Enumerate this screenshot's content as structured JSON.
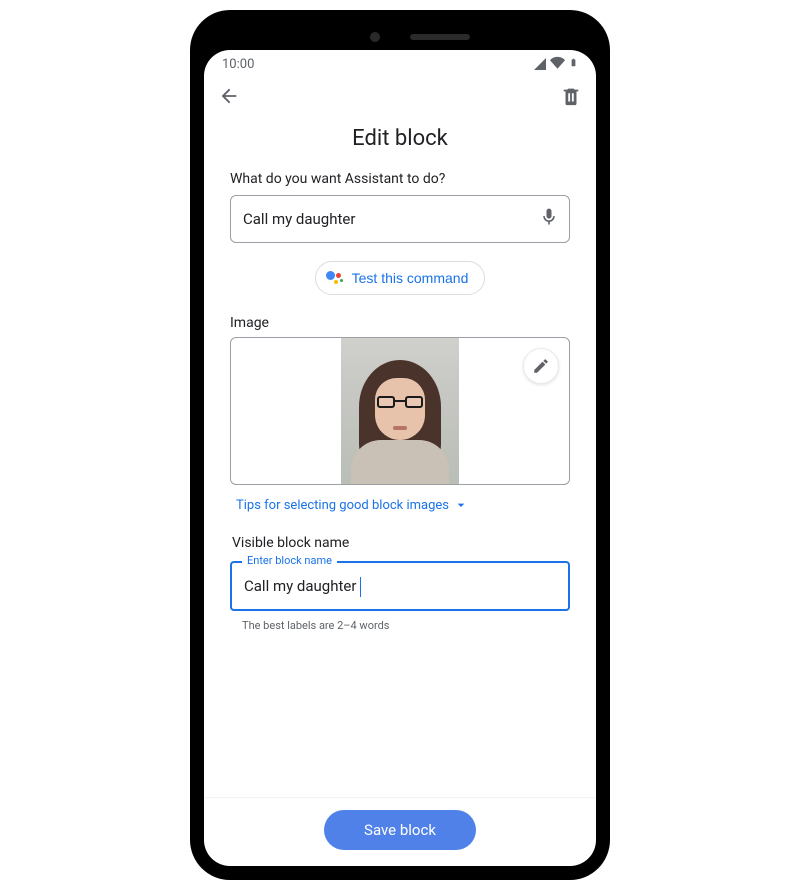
{
  "statusBar": {
    "time": "10:00"
  },
  "page": {
    "title": "Edit block"
  },
  "commandField": {
    "label": "What do you want Assistant to do?",
    "value": "Call my daughter"
  },
  "testButton": {
    "label": "Test this command"
  },
  "imageSection": {
    "label": "Image",
    "tipsLink": "Tips for selecting good block images"
  },
  "blockNameField": {
    "sectionLabel": "Visible block name",
    "floatingLabel": "Enter block name",
    "value": "Call my daughter",
    "helper": "The best labels are 2–4 words"
  },
  "footer": {
    "saveLabel": "Save block"
  }
}
